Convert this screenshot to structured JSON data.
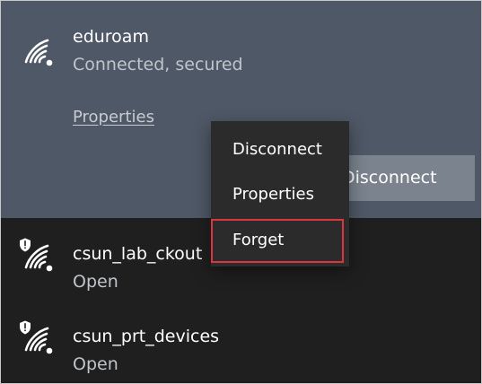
{
  "selected_network": {
    "name": "eduroam",
    "status": "Connected, secured",
    "properties_link": "Properties",
    "disconnect_button": "Disconnect"
  },
  "networks": [
    {
      "name": "csun_lab_ckout",
      "status": "Open"
    },
    {
      "name": "csun_prt_devices",
      "status": "Open"
    }
  ],
  "context_menu": {
    "items": [
      "Disconnect",
      "Properties",
      "Forget"
    ]
  },
  "colors": {
    "active_panel": "#4f5866",
    "dark_list": "#1f1f1f",
    "menu_bg": "#2b2b2b",
    "highlight": "#d9363e"
  },
  "icons": {
    "wifi": "wifi-icon",
    "shield": "shield-icon"
  }
}
